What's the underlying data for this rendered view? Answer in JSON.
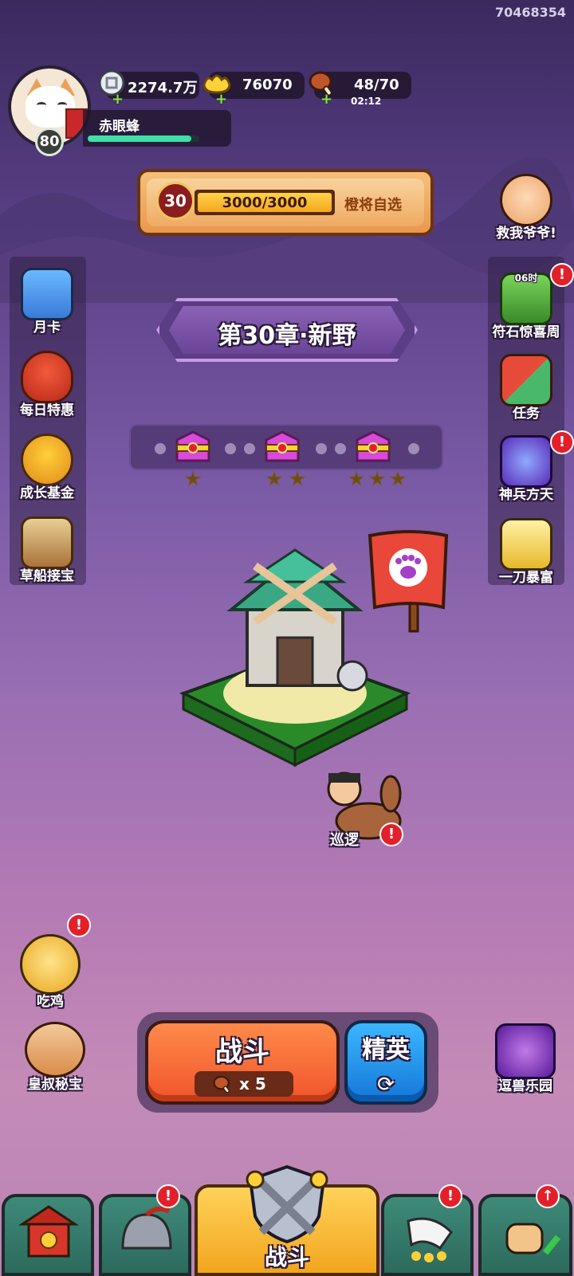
{
  "player": {
    "id": "70468354",
    "name": "赤眼蜂",
    "level": "80",
    "xp_fraction": 0.93
  },
  "resources": {
    "silver": "2274.7万",
    "gold": "76070",
    "stamina": "48/70",
    "stamina_timer": "02:12"
  },
  "boss_progress": {
    "level": "30",
    "progress_text": "3000/3000",
    "progress_fraction": 1.0,
    "action_label": "橙将自选"
  },
  "left_menu": [
    {
      "label": "月卡",
      "icon": "month-card-icon"
    },
    {
      "label": "每日特惠",
      "icon": "daily-deal-bag-icon"
    },
    {
      "label": "成长基金",
      "icon": "growth-fund-icon"
    },
    {
      "label": "草船接宝",
      "icon": "straw-boat-icon"
    }
  ],
  "right_menu": [
    {
      "label": "救我爷爷!",
      "icon": "rescue-grandpa-icon",
      "alert": false
    },
    {
      "label": "符石惊喜周",
      "icon": "rune-week-icon",
      "badge": "06时",
      "alert": true
    },
    {
      "label": "任务",
      "icon": "task-scroll-icon",
      "alert": false
    },
    {
      "label": "神兵方天",
      "icon": "divine-weapon-icon",
      "alert": true
    },
    {
      "label": "一刀暴富",
      "icon": "slash-fortune-icon",
      "alert": false
    }
  ],
  "chapter": {
    "title": "第30章·新野"
  },
  "star_chests": [
    {
      "stars": 1
    },
    {
      "stars": 2
    },
    {
      "stars": 3
    }
  ],
  "map": {
    "patrol_label": "巡逻",
    "patrol_alert": true
  },
  "bottom_left": [
    {
      "label": "吃鸡",
      "icon": "eat-chicken-icon",
      "alert": true
    },
    {
      "label": "皇叔秘宝",
      "icon": "uncle-treasure-icon",
      "alert": false
    }
  ],
  "bottom_right": {
    "label": "逗兽乐园",
    "icon": "beast-park-icon"
  },
  "battle": {
    "label": "战斗",
    "cost": "x 5",
    "elite_label": "精英"
  },
  "bottom_nav": [
    {
      "icon": "city-gate-icon",
      "alert": false
    },
    {
      "icon": "helmet-icon",
      "alert": true
    },
    {
      "label": "战斗",
      "icon": "crossed-swords-shield-icon",
      "active": true
    },
    {
      "icon": "horn-cards-icon",
      "alert": true
    },
    {
      "icon": "power-fist-icon",
      "alert": true
    }
  ],
  "colors": {
    "accent_orange": "#f0542a",
    "accent_blue": "#1477d8",
    "alert_red": "#e3202a",
    "xp_green": "#3fe0a8",
    "nav_active": "#f2a51e",
    "nav_inactive": "#2c6a5c"
  }
}
